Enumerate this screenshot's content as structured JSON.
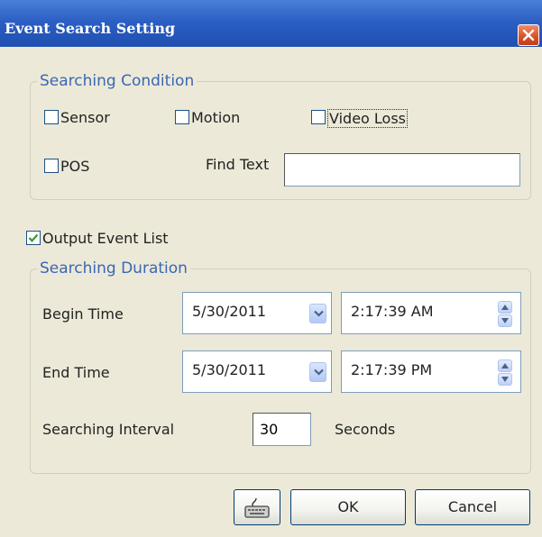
{
  "window": {
    "title": "Event Search Setting"
  },
  "searching_condition": {
    "legend": "Searching Condition",
    "sensor_label": "Sensor",
    "motion_label": "Motion",
    "video_loss_label": "Video Loss",
    "pos_label": "POS",
    "find_text_label": "Find Text",
    "find_text_value": "",
    "checked": {
      "sensor": false,
      "motion": false,
      "video_loss": false,
      "pos": false
    }
  },
  "output_event_list": {
    "label": "Output Event List",
    "checked": true
  },
  "searching_duration": {
    "legend": "Searching Duration",
    "begin_label": "Begin Time",
    "begin_date": "5/30/2011",
    "begin_time": "2:17:39 AM",
    "end_label": "End Time",
    "end_date": "5/30/2011",
    "end_time": "2:17:39 PM",
    "interval_label": "Searching Interval",
    "interval_value": "30",
    "interval_unit": "Seconds"
  },
  "buttons": {
    "keyboard_icon": "keyboard-icon",
    "ok": "OK",
    "cancel": "Cancel"
  },
  "colors": {
    "titlebar": "#2c5fc4",
    "legend": "#3a67b4",
    "close": "#d9542a",
    "check": "#2f9b2f"
  }
}
